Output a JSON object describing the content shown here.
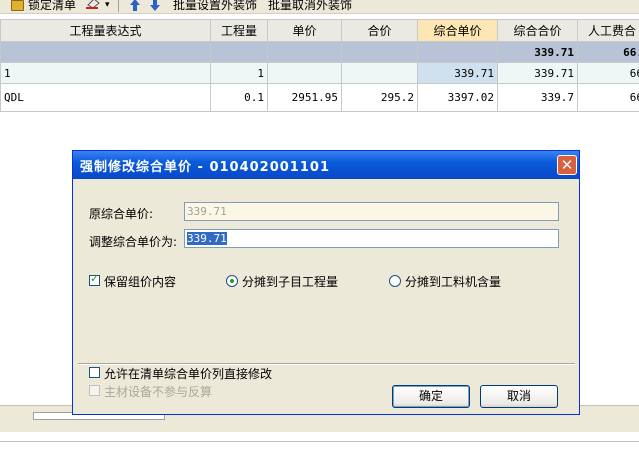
{
  "toolbar": {
    "lock_label": "锁定清单",
    "batch_set_label": "批量设置外装饰",
    "batch_cancel_label": "批量取消外装饰"
  },
  "grid": {
    "headers": [
      "工程量表达式",
      "工程量",
      "单价",
      "合价",
      "综合单价",
      "综合合价",
      "人工费合"
    ],
    "summary": [
      "",
      "",
      "",
      "",
      "",
      "339.71",
      "66."
    ],
    "rows": [
      [
        "1",
        "1",
        "",
        "",
        "339.71",
        "339.71",
        "66"
      ],
      [
        "QDL",
        "0.1",
        "2951.95",
        "295.2",
        "3397.02",
        "339.7",
        "66"
      ]
    ]
  },
  "dialog": {
    "title": "强制修改综合单价 - 010402001101",
    "original_label": "原综合单价:",
    "original_value": "339.71",
    "adjust_label": "调整综合单价为:",
    "adjust_value": "339.71",
    "keep_label": "保留组价内容",
    "keep_checked": true,
    "radio1_label": "分摊到子目工程量",
    "radio2_label": "分摊到工料机含量",
    "allow_label": "允许在清单综合单价列直接修改",
    "material_label": "主材设备不参与反算",
    "ok_label": "确定",
    "cancel_label": "取消"
  },
  "colors": {
    "titlebar": "#0a5bda",
    "summary_row": "#b8c3d8",
    "highlight_header": "#fbe6b4"
  }
}
